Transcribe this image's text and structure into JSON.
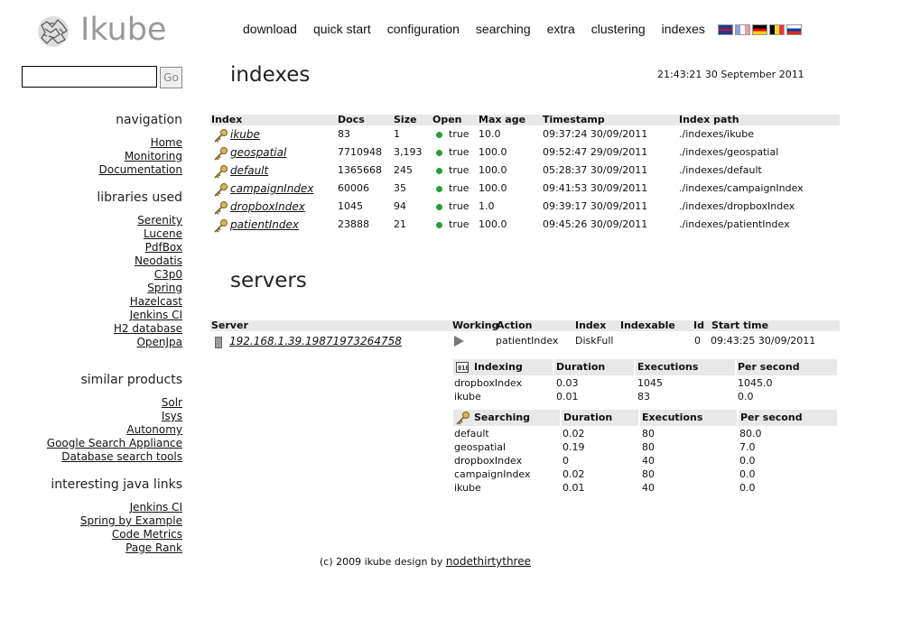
{
  "brand": {
    "name": "Ikube"
  },
  "topnav": [
    "download",
    "quick start",
    "configuration",
    "searching",
    "extra",
    "clustering",
    "indexes"
  ],
  "flags": [
    {
      "name": "uk-flag-icon",
      "color": "#1f3c8a"
    },
    {
      "name": "france-flag-icon",
      "color": "#d8dff0"
    },
    {
      "name": "germany-flag-icon",
      "color": "#d4a000"
    },
    {
      "name": "belgium-flag-icon",
      "color": "#d71a21"
    },
    {
      "name": "russia-flag-icon",
      "color": "#2a49a8"
    }
  ],
  "search": {
    "value": "",
    "button": "Go"
  },
  "sidebar": {
    "navigation": {
      "title": "navigation",
      "links": [
        "Home",
        "Monitoring",
        "Documentation"
      ]
    },
    "libraries": {
      "title": "libraries used",
      "links": [
        "Serenity",
        "Lucene",
        "PdfBox",
        "Neodatis",
        "C3p0",
        "Spring",
        "Hazelcast",
        "Jenkins CI",
        "H2 database",
        "OpenJpa"
      ]
    },
    "similar": {
      "title": "similar products",
      "links": [
        "Solr",
        "Isys",
        "Autonomy",
        "Google Search Appliance",
        "Database search tools"
      ]
    },
    "java": {
      "title": "interesting java links",
      "links": [
        "Jenkins CI",
        "Spring by Example",
        "Code Metrics",
        "Page Rank"
      ]
    }
  },
  "indexes": {
    "title": "indexes",
    "timestamp": "21:43:21 30 September 2011",
    "headers": [
      "Index",
      "Docs",
      "Size",
      "Open",
      "Max age",
      "Timestamp",
      "Index path"
    ],
    "rows": [
      {
        "index": "ikube",
        "docs": "83",
        "size": "1",
        "open": "true",
        "maxage": "10.0",
        "ts": "09:37:24 30/09/2011",
        "path": "./indexes/ikube"
      },
      {
        "index": "geospatial",
        "docs": "7710948",
        "size": "3,193",
        "open": "true",
        "maxage": "100.0",
        "ts": "09:52:47 29/09/2011",
        "path": "./indexes/geospatial"
      },
      {
        "index": "default",
        "docs": "1365668",
        "size": "245",
        "open": "true",
        "maxage": "100.0",
        "ts": "05:28:37 30/09/2011",
        "path": "./indexes/default"
      },
      {
        "index": "campaignIndex",
        "docs": "60006",
        "size": "35",
        "open": "true",
        "maxage": "100.0",
        "ts": "09:41:53 30/09/2011",
        "path": "./indexes/campaignIndex"
      },
      {
        "index": "dropboxIndex",
        "docs": "1045",
        "size": "94",
        "open": "true",
        "maxage": "1.0",
        "ts": "09:39:17 30/09/2011",
        "path": "./indexes/dropboxIndex"
      },
      {
        "index": "patientIndex",
        "docs": "23888",
        "size": "21",
        "open": "true",
        "maxage": "100.0",
        "ts": "09:45:26 30/09/2011",
        "path": "./indexes/patientIndex"
      }
    ]
  },
  "servers": {
    "title": "servers",
    "headers": [
      "Server",
      "Working",
      "Action",
      "Index",
      "Indexable",
      "Id",
      "Start time"
    ],
    "row": {
      "server": "192.168.1.39.19871973264758",
      "action": "patientIndex",
      "index": "DiskFull",
      "indexable": "",
      "id": "0",
      "start": "09:43:25 30/09/2011"
    },
    "indexing": {
      "headers": [
        "Indexing",
        "Duration",
        "Executions",
        "Per second"
      ],
      "rows": [
        [
          "dropboxIndex",
          "0.03",
          "1045",
          "1045.0"
        ],
        [
          "ikube",
          "0.01",
          "83",
          "0.0"
        ]
      ]
    },
    "searching": {
      "headers": [
        "Searching",
        "Duration",
        "Executions",
        "Per second"
      ],
      "rows": [
        [
          "default",
          "0.02",
          "80",
          "80.0"
        ],
        [
          "geospatial",
          "0.19",
          "80",
          "7.0"
        ],
        [
          "dropboxIndex",
          "0",
          "40",
          "0.0"
        ],
        [
          "campaignIndex",
          "0.02",
          "80",
          "0.0"
        ],
        [
          "ikube",
          "0.01",
          "40",
          "0.0"
        ]
      ]
    }
  },
  "footer": {
    "text": "(c) 2009 ikube design by",
    "link": "nodethirtythree"
  }
}
